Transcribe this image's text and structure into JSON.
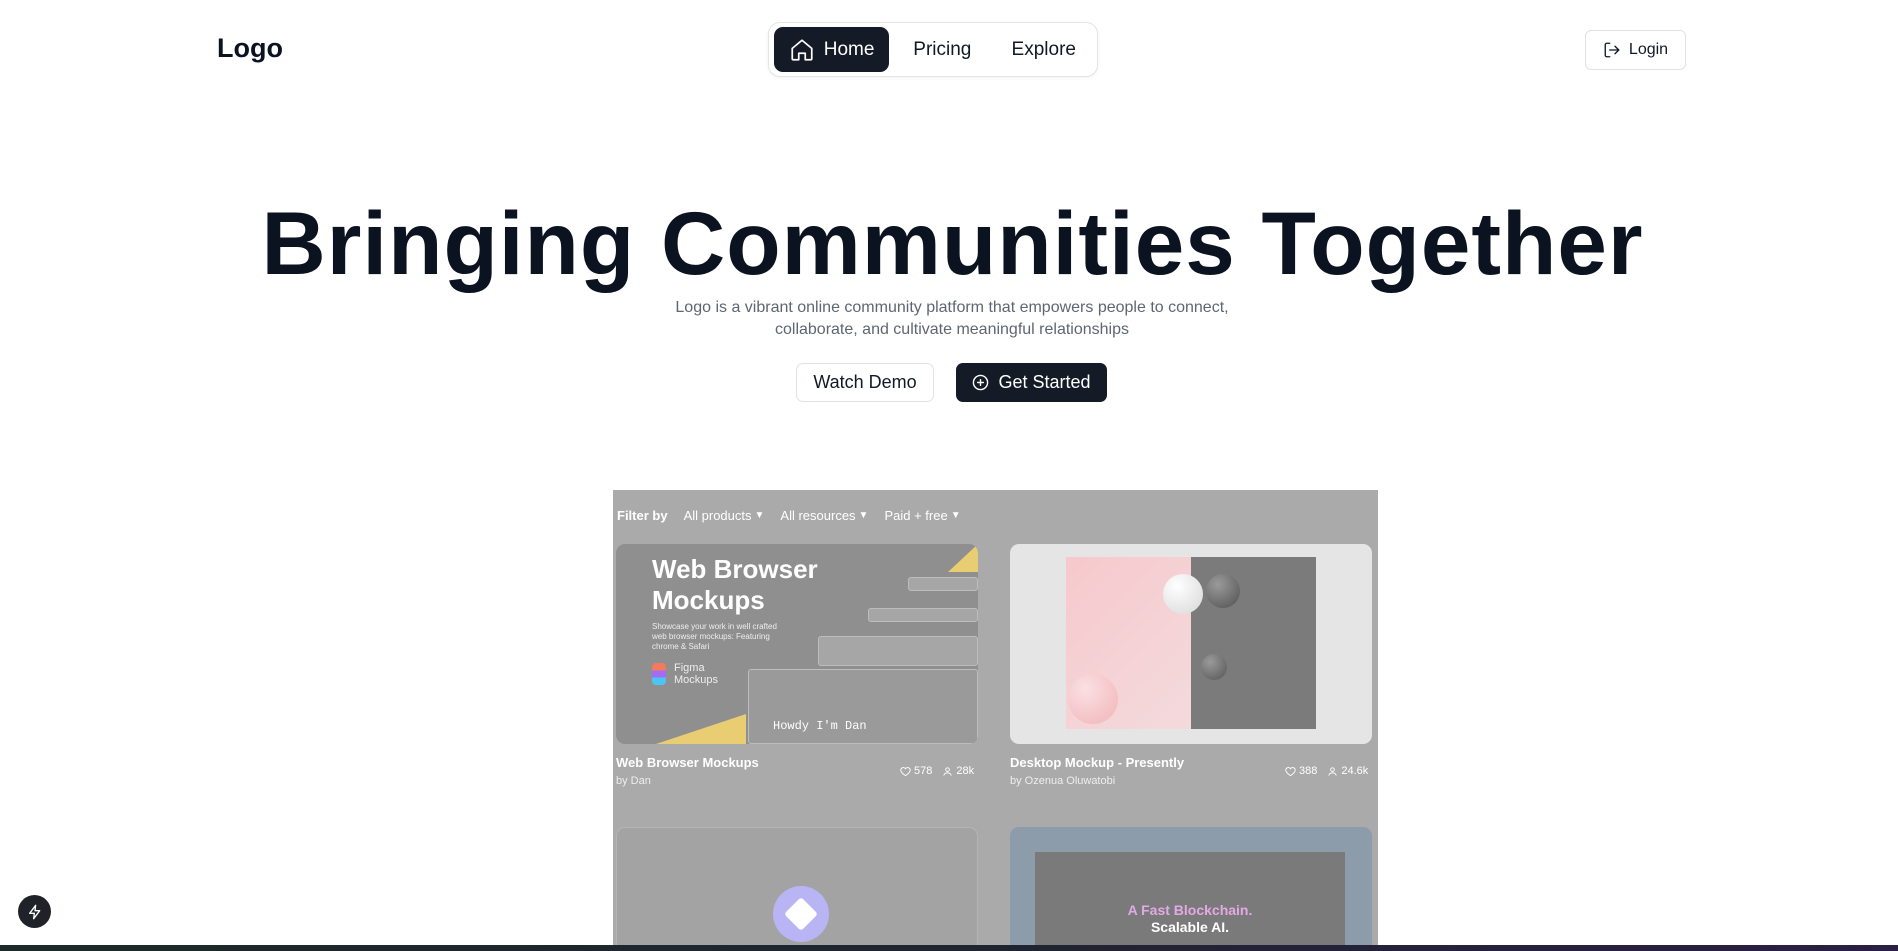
{
  "header": {
    "logo": "Logo",
    "nav": [
      {
        "label": "Home",
        "active": true,
        "icon": "home-icon"
      },
      {
        "label": "Pricing",
        "active": false
      },
      {
        "label": "Explore",
        "active": false
      }
    ],
    "login_label": "Login"
  },
  "hero": {
    "title": "Bringing Communities Together",
    "subtitle_line1": "Logo is a vibrant online community platform that empowers people to connect,",
    "subtitle_line2": "collaborate, and cultivate meaningful relationships",
    "demo_label": "Watch Demo",
    "start_label": "Get Started"
  },
  "preview": {
    "filter_label": "Filter by",
    "filters": [
      "All products",
      "All resources",
      "Paid + free"
    ],
    "cards": [
      {
        "title": "Web Browser Mockups",
        "author": "by Dan",
        "likes": "578",
        "users": "28k",
        "thumb_title_line1": "Web Browser",
        "thumb_title_line2": "Mockups",
        "thumb_desc": "Showcase your work in well crafted web browser mockups: Featuring chrome & Safari",
        "thumb_figma_line1": "Figma",
        "thumb_figma_line2": "Mockups",
        "thumb_howdy": "Howdy I'm Dan"
      },
      {
        "title": "Desktop Mockup - Presently",
        "author": "by Ozenua Oluwatobi",
        "likes": "388",
        "users": "24.6k"
      },
      {
        "thumb_line1": "A Fast Blockchain.",
        "thumb_line2": "Scalable AI."
      }
    ]
  },
  "colors": {
    "primary_dark": "#141a26",
    "border": "#dfe2e6",
    "muted_text": "#5f6672",
    "overlay_gray": "#aaaaaa"
  }
}
